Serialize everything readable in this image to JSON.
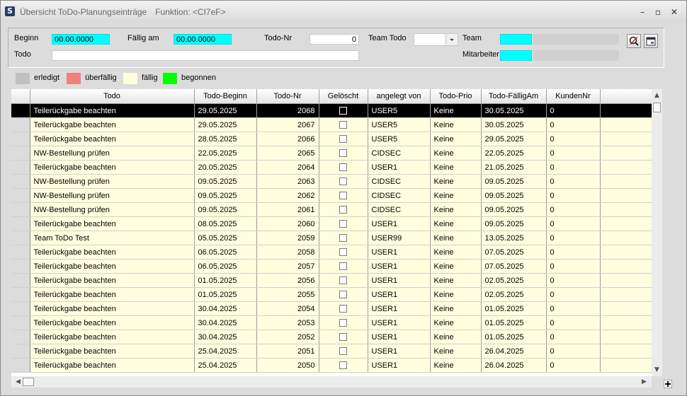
{
  "window": {
    "title": "Übersicht ToDo-Planungseinträge",
    "function_label": "Funktion: <CI7eF>",
    "app_icon_glyph": "S",
    "minimize_glyph": "–",
    "maximize_glyph": "▫",
    "close_glyph": "✕"
  },
  "filters": {
    "beginn_label": "Beginn",
    "beginn_value": "00.00.0000",
    "faellig_label": "Fällig am",
    "faellig_value": "00.00.0000",
    "todonr_label": "Todo-Nr",
    "todonr_value": "0",
    "teamtodo_label": "Team Todo",
    "teamtodo_value": "",
    "team_label": "Team",
    "team_value": "",
    "team_name": "",
    "todo_label": "Todo",
    "todo_value": "",
    "mitarbeiter_label": "Mitarbeiter",
    "mitarbeiter_value": "",
    "mitarbeiter_name": ""
  },
  "legend": [
    {
      "label": "erledigt",
      "color": "#c0c0c0"
    },
    {
      "label": "überfällig",
      "color": "#f08080"
    },
    {
      "label": "fällig",
      "color": "#ffffe0"
    },
    {
      "label": "begonnen",
      "color": "#00ff00"
    }
  ],
  "colors": {
    "filter_highlight": "#00ffff",
    "selected_row": "#000000",
    "row_due": "#ffffe0"
  },
  "table": {
    "columns": [
      "Todo",
      "Todo-Beginn",
      "Todo-Nr",
      "Gelöscht",
      "angelegt von",
      "Todo-Prio",
      "Todo-FälligAm",
      "KundenNr"
    ],
    "rows": [
      [
        "Teilerückgabe beachten",
        "29.05.2025",
        "2068",
        "",
        "USER5",
        "Keine",
        "30.05.2025",
        "0"
      ],
      [
        "Teilerückgabe beachten",
        "29.05.2025",
        "2067",
        "",
        "USER5",
        "Keine",
        "30.05.2025",
        "0"
      ],
      [
        "Teilerückgabe beachten",
        "28.05.2025",
        "2066",
        "",
        "USER5",
        "Keine",
        "29.05.2025",
        "0"
      ],
      [
        "NW-Bestellung prüfen",
        "22.05.2025",
        "2065",
        "",
        "CIDSEC",
        "Keine",
        "22.05.2025",
        "0"
      ],
      [
        "Teilerückgabe beachten",
        "20.05.2025",
        "2064",
        "",
        "USER1",
        "Keine",
        "21.05.2025",
        "0"
      ],
      [
        "NW-Bestellung prüfen",
        "09.05.2025",
        "2063",
        "",
        "CIDSEC",
        "Keine",
        "09.05.2025",
        "0"
      ],
      [
        "NW-Bestellung prüfen",
        "09.05.2025",
        "2062",
        "",
        "CIDSEC",
        "Keine",
        "09.05.2025",
        "0"
      ],
      [
        "NW-Bestellung prüfen",
        "09.05.2025",
        "2061",
        "",
        "CIDSEC",
        "Keine",
        "09.05.2025",
        "0"
      ],
      [
        "Teilerückgabe beachten",
        "08.05.2025",
        "2060",
        "",
        "USER1",
        "Keine",
        "09.05.2025",
        "0"
      ],
      [
        "Team ToDo Test",
        "05.05.2025",
        "2059",
        "",
        "USER99",
        "Keine",
        "13.05.2025",
        "0"
      ],
      [
        "Teilerückgabe beachten",
        "06.05.2025",
        "2058",
        "",
        "USER1",
        "Keine",
        "07.05.2025",
        "0"
      ],
      [
        "Teilerückgabe beachten",
        "06.05.2025",
        "2057",
        "",
        "USER1",
        "Keine",
        "07.05.2025",
        "0"
      ],
      [
        "Teilerückgabe beachten",
        "01.05.2025",
        "2056",
        "",
        "USER1",
        "Keine",
        "02.05.2025",
        "0"
      ],
      [
        "Teilerückgabe beachten",
        "01.05.2025",
        "2055",
        "",
        "USER1",
        "Keine",
        "02.05.2025",
        "0"
      ],
      [
        "Teilerückgabe beachten",
        "30.04.2025",
        "2054",
        "",
        "USER1",
        "Keine",
        "01.05.2025",
        "0"
      ],
      [
        "Teilerückgabe beachten",
        "30.04.2025",
        "2053",
        "",
        "USER1",
        "Keine",
        "01.05.2025",
        "0"
      ],
      [
        "Teilerückgabe beachten",
        "30.04.2025",
        "2052",
        "",
        "USER1",
        "Keine",
        "01.05.2025",
        "0"
      ],
      [
        "Teilerückgabe beachten",
        "25.04.2025",
        "2051",
        "",
        "USER1",
        "Keine",
        "26.04.2025",
        "0"
      ],
      [
        "Teilerückgabe beachten",
        "25.04.2025",
        "2050",
        "",
        "USER1",
        "Keine",
        "26.04.2025",
        "0"
      ]
    ],
    "selected_index": 0
  },
  "icons": {
    "search_clear": "search-clear-icon",
    "calendar": "calendar-icon",
    "dropdown": "chevron-down-icon",
    "scroll_up": "arrow-up-icon",
    "scroll_down": "arrow-down-icon",
    "scroll_left": "arrow-left-icon",
    "scroll_right": "arrow-right-icon"
  }
}
